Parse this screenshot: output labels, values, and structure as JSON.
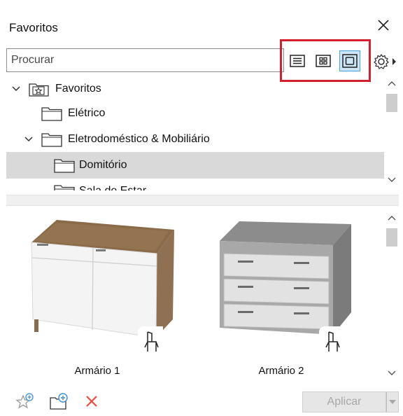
{
  "window": {
    "title": "Favoritos"
  },
  "search": {
    "placeholder": "Procurar"
  },
  "view_modes": [
    {
      "icon": "list-view-icon",
      "active": false
    },
    {
      "icon": "grid-view-icon",
      "active": false
    },
    {
      "icon": "preview-view-icon",
      "active": true
    }
  ],
  "settings_icon": "gear-icon",
  "tree": {
    "items": [
      {
        "label": "Favoritos",
        "expanded": true,
        "icon": "star-folder-icon"
      },
      {
        "label": "Elétrico",
        "icon": "folder-icon"
      },
      {
        "label": "Eletrodoméstico & Mobiliário",
        "expanded": true,
        "icon": "folder-icon"
      },
      {
        "label": "Domitório",
        "icon": "folder-icon",
        "selected": true
      },
      {
        "label": "Sala de Estar",
        "icon": "folder-icon"
      }
    ]
  },
  "gallery": {
    "items": [
      {
        "caption": "Armário 1",
        "badge_icon": "chair-icon"
      },
      {
        "caption": "Armário 2",
        "badge_icon": "chair-icon"
      }
    ]
  },
  "footer": {
    "apply_label": "Aplicar",
    "icons": [
      "add-favorite-icon",
      "new-folder-icon",
      "delete-icon"
    ]
  },
  "colors": {
    "highlight": "#d2202c",
    "active_view_bg": "#cde6f7",
    "delete": "#ee4b3c",
    "add_icon": "#3c8fd8"
  }
}
